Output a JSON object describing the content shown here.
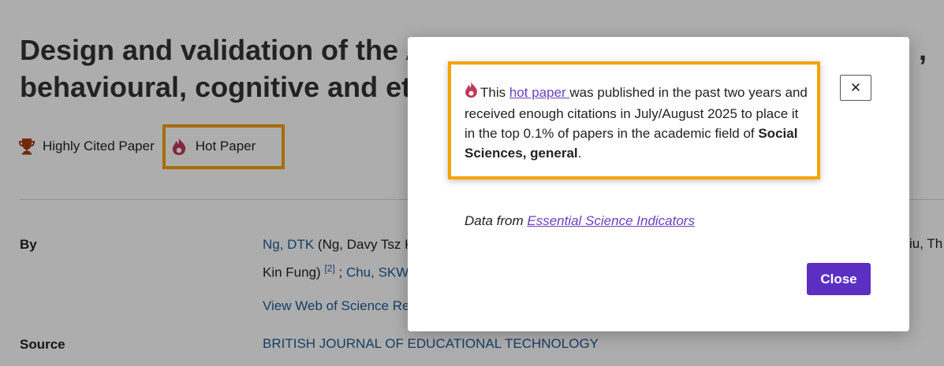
{
  "article": {
    "title_line1": "Design and validation of the A",
    "title_comma": ",",
    "title_line2": "behavioural, cognitive and et"
  },
  "badges": {
    "highly_cited": "Highly Cited Paper",
    "hot_paper": "Hot Paper"
  },
  "metadata": {
    "by_label": "By",
    "author1_link": "Ng, DTK",
    "author1_full": " (Ng, Davy Tsz K",
    "author_line2_prefix": "Kin Fung)",
    "author_ref": "[2]",
    "author_sep": " ; ",
    "author2_link": "Chu, SKW",
    "right_fragment": "iu, Th",
    "wos_link": "View Web of Science Re",
    "source_label": "Source",
    "source_value": "BRITISH JOURNAL OF EDUCATIONAL TECHNOLOGY"
  },
  "modal": {
    "text_this": "This ",
    "hot_paper_link": "hot paper ",
    "text_rest": "was published in the past two years and received enough citations in July/August 2025 to place it in the top 0.1% of papers in the academic field of ",
    "field": "Social Sciences, general",
    "period": ".",
    "close_x": "✕",
    "data_from_label": "Data from ",
    "data_source_link": "Essential Science Indicators",
    "close_button": "Close"
  },
  "colors": {
    "highlight": "#f5a300",
    "primary_button": "#5b2fc2",
    "link": "#6b3fbf",
    "flame": "#c0395a",
    "trophy": "#a83a10"
  }
}
